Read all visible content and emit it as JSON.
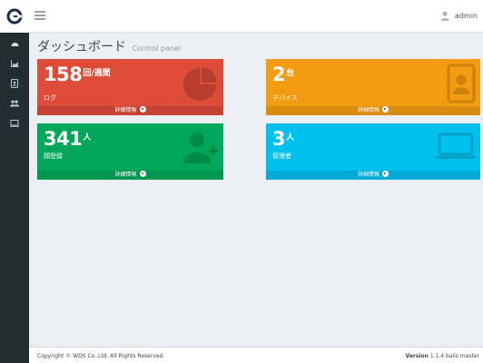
{
  "header": {
    "user_name": "admin"
  },
  "sidebar": {
    "items": [
      {
        "icon": "dashboard-icon"
      },
      {
        "icon": "area-chart-icon"
      },
      {
        "icon": "tablet-icon"
      },
      {
        "icon": "users-icon"
      },
      {
        "icon": "monitor-icon"
      }
    ]
  },
  "page": {
    "title": "ダッシュボード",
    "subtitle": "Control panel"
  },
  "boxes": [
    {
      "value": "158",
      "unit": "回/週間",
      "label": "ログ",
      "more": "詳細情報",
      "color": "#dd4b39",
      "icon": "pie-chart-icon"
    },
    {
      "value": "2",
      "unit": "台",
      "label": "デバイス",
      "more": "詳細情報",
      "color": "#f39c12",
      "icon": "id-badge-icon"
    },
    {
      "value": "341",
      "unit": "人",
      "label": "顔登録",
      "more": "詳細情報",
      "color": "#00a65a",
      "icon": "user-plus-icon"
    },
    {
      "value": "3",
      "unit": "人",
      "label": "管理者",
      "more": "詳細情報",
      "color": "#00c0ef",
      "icon": "laptop-icon"
    }
  ],
  "footer": {
    "copyright": "Copyright © WDS Co.,Ltd. All Rights Reserved.",
    "version_label": "Version",
    "version_value": "1.1.4 balis master"
  }
}
